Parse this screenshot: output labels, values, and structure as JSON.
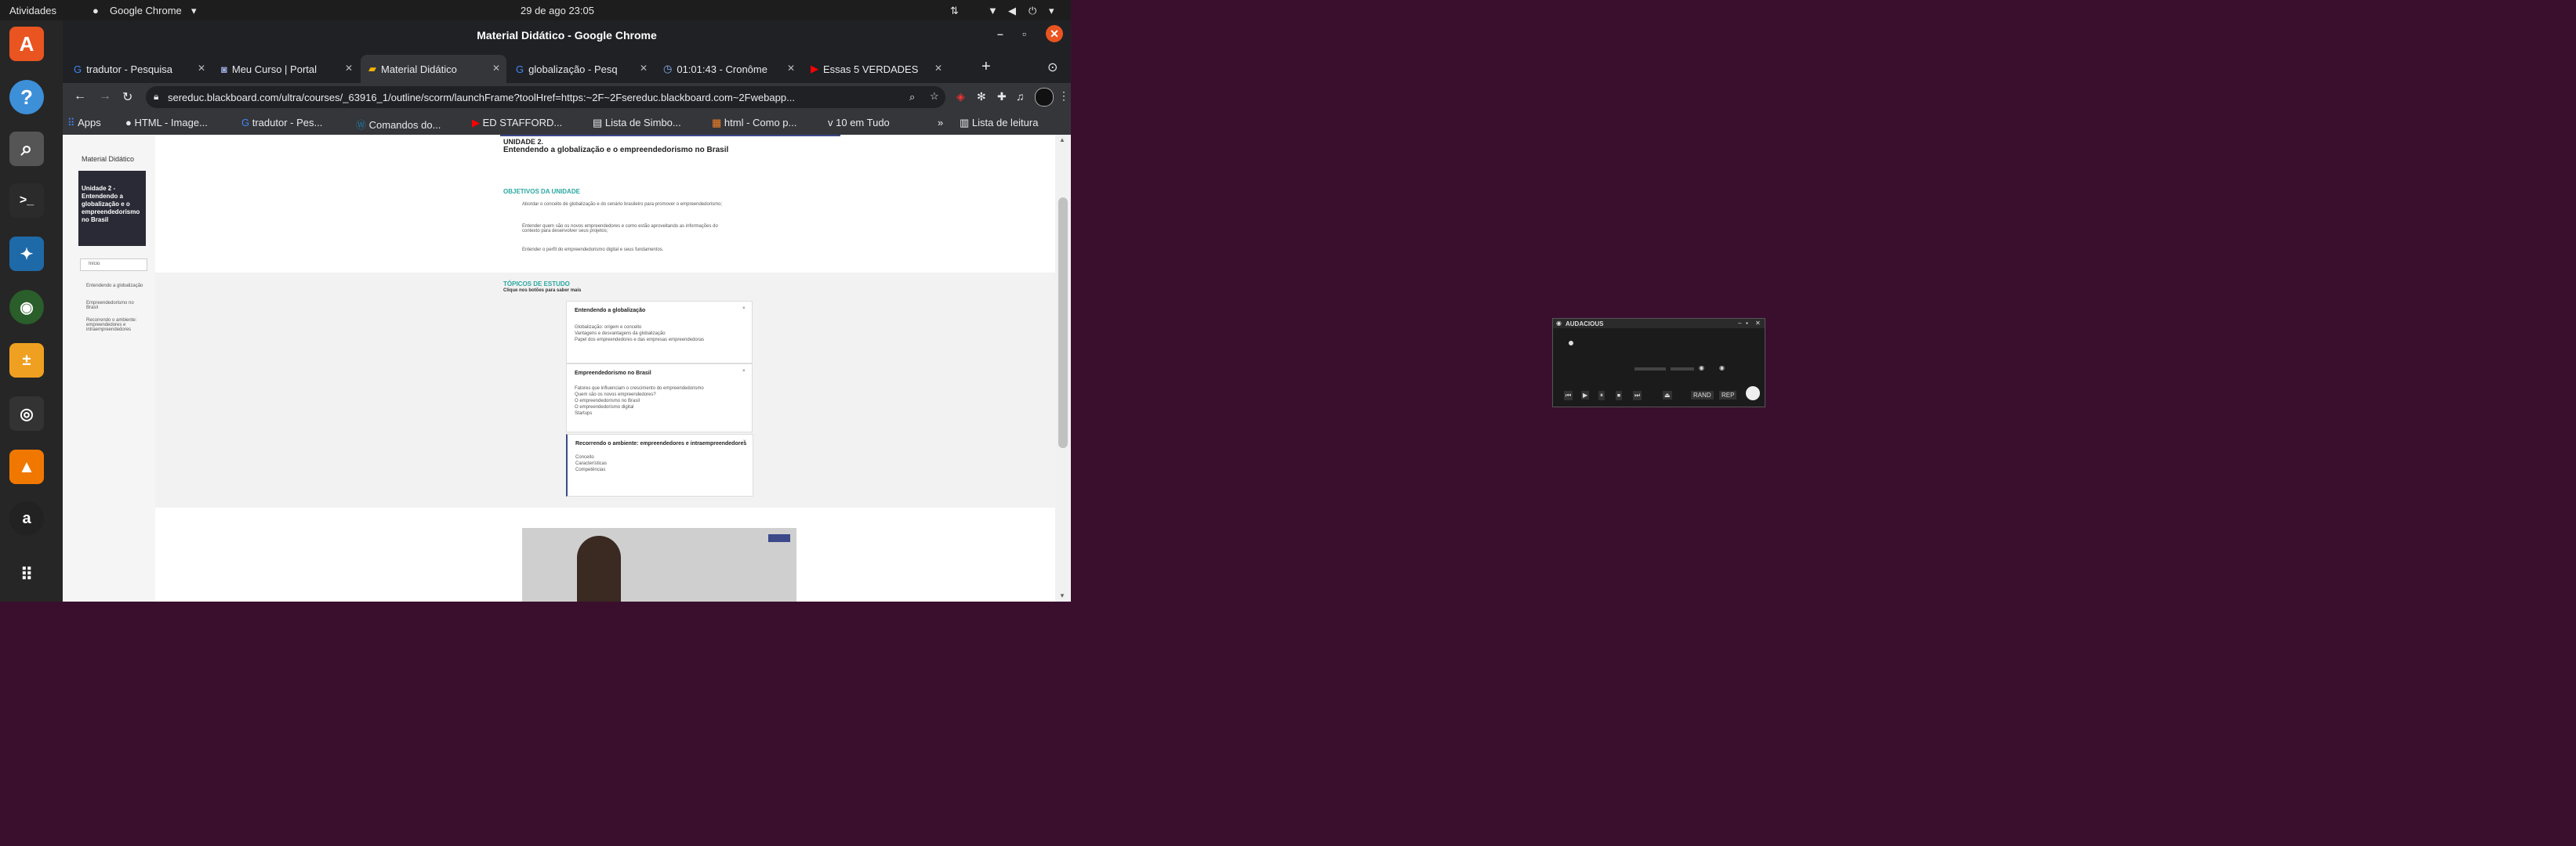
{
  "topbar": {
    "activities": "Atividades",
    "app_name": "Google Chrome",
    "datetime": "29 de ago  23:05"
  },
  "window": {
    "title": "Material Didático - Google Chrome"
  },
  "tabs": [
    {
      "label": "tradutor - Pesquisa",
      "icon": "google-icon"
    },
    {
      "label": "Meu Curso | Portal",
      "icon": "portal-icon"
    },
    {
      "label": "Material Didático",
      "icon": "blackboard-icon",
      "active": true
    },
    {
      "label": "globalização - Pesq",
      "icon": "google-icon"
    },
    {
      "label": "01:01:43 - Cronôme",
      "icon": "clock-icon"
    },
    {
      "label": "Essas 5 VERDADES",
      "icon": "youtube-icon"
    }
  ],
  "address": {
    "url": "sereduc.blackboard.com/ultra/courses/_63916_1/outline/scorm/launchFrame?toolHref=https:~2F~2Fsereduc.blackboard.com~2Fwebapp..."
  },
  "bookmarks": [
    {
      "label": "Apps",
      "icon": "apps-grid-icon"
    },
    {
      "label": "HTML - Image...",
      "icon": "github-icon"
    },
    {
      "label": "tradutor - Pes...",
      "icon": "google-icon"
    },
    {
      "label": "Comandos do...",
      "icon": "wordpress-icon"
    },
    {
      "label": "ED STAFFORD...",
      "icon": "youtube-icon"
    },
    {
      "label": "Lista de Simbo...",
      "icon": "doc-icon"
    },
    {
      "label": "html - Como p...",
      "icon": "stackoverflow-icon"
    },
    {
      "label": "10 em Tudo",
      "icon": "v-icon"
    }
  ],
  "bookmarks_more": "»",
  "reading_list": "Lista de leitura",
  "course": {
    "breadcrumb": "Material Didático",
    "card_title": "Unidade 2 - Entendendo a globalização e o empreendedorismo no Brasil",
    "nav_items": [
      "Início",
      "Entendendo a globalização",
      "Empreendedorismo no Brasil",
      "Recorrendo o ambiente: empreendedores e intraempreendedores"
    ]
  },
  "document": {
    "unit_label": "UNIDADE 2.",
    "unit_title": "Entendendo a globalização e o empreendedorismo no Brasil",
    "objectives_heading": "OBJETIVOS DA UNIDADE",
    "objectives": [
      "Abordar o conceito de globalização e do cenário brasileiro para promover o empreendedorismo;",
      "Entender quem são os novos empreendedores e como estão aproveitando as informações do contexto para desenvolver seus projetos;",
      "Entender o perfil do empreendedorismo digital e seus fundamentos."
    ],
    "topics_heading": "TÓPICOS DE ESTUDO",
    "topics_sub": "Clique nos botões para saber mais",
    "topic_cards": [
      {
        "title": "Entendendo a globalização",
        "items": [
          "Globalização: origem e conceito",
          "Vantagens e desvantagens da globalização",
          "Papel dos empreendedores e das empresas empreendedoras"
        ]
      },
      {
        "title": "Empreendedorismo no Brasil",
        "items": [
          "Fatores que influenciam o crescimento do empreendedorismo",
          "Quem são os novos empreendedores?",
          "O empreendedorismo no Brasil",
          "O empreendedorismo digital",
          "Startups"
        ]
      },
      {
        "title": "Recorrendo o ambiente: empreendedores e intraempreendedores",
        "items": [
          "Conceito",
          "Características",
          "Competências"
        ]
      }
    ]
  },
  "audacious": {
    "title": "AUDACIOUS",
    "buttons": [
      "⏮",
      "▶",
      "⏸",
      "⏹",
      "⏭",
      "⏏"
    ],
    "shuffle": "RAND",
    "repeat": "REP"
  }
}
